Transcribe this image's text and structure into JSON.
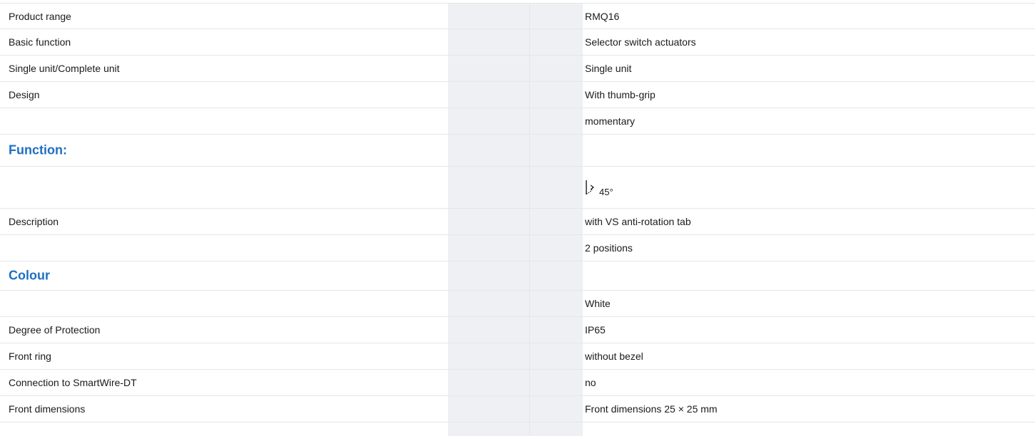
{
  "rows": [
    {
      "label": "Product range",
      "value": "RMQ16"
    },
    {
      "label": "Basic function",
      "value": "Selector switch actuators"
    },
    {
      "label": "Single unit/Complete unit",
      "value": "Single unit"
    },
    {
      "label": "Design",
      "value": "With thumb-grip"
    },
    {
      "label": "",
      "value": "momentary"
    }
  ],
  "function_section": {
    "heading": "Function:",
    "icon": "selector-45-degree-icon",
    "angle": "45°"
  },
  "description_rows": [
    {
      "label": "Description",
      "value": "with VS anti-rotation tab"
    },
    {
      "label": "",
      "value": "2 positions"
    }
  ],
  "colour_section": {
    "heading": "Colour"
  },
  "colour_rows": [
    {
      "label": "",
      "value": "White"
    },
    {
      "label": "Degree of Protection",
      "value": "IP65"
    },
    {
      "label": "Front ring",
      "value": "without bezel"
    },
    {
      "label": "Connection to SmartWire-DT",
      "value": "no"
    },
    {
      "label": "Front dimensions",
      "value": "Front dimensions 25 × 25 mm"
    }
  ],
  "colors": {
    "heading": "#1d6fc2",
    "gray_column": "#eef0f3",
    "divider": "#e4e6ea"
  }
}
